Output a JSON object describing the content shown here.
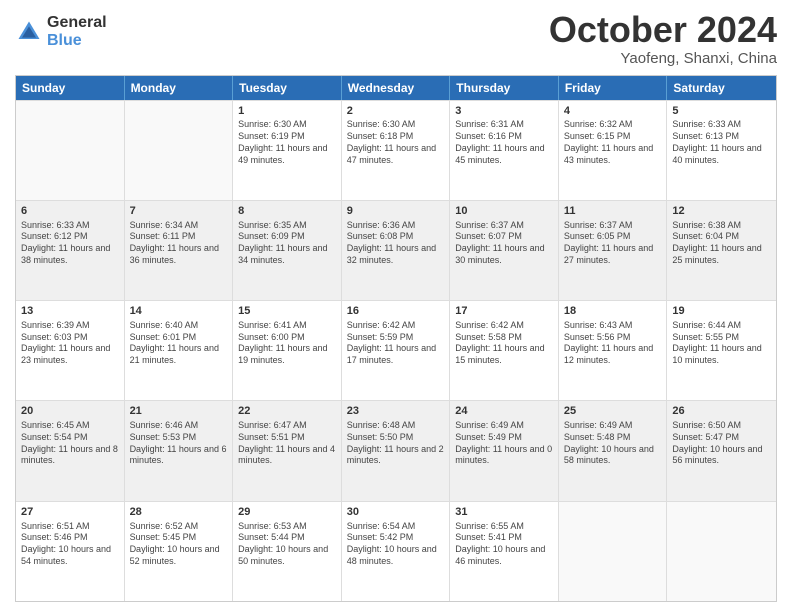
{
  "header": {
    "logo_line1": "General",
    "logo_line2": "Blue",
    "month_title": "October 2024",
    "location": "Yaofeng, Shanxi, China"
  },
  "weekdays": [
    "Sunday",
    "Monday",
    "Tuesday",
    "Wednesday",
    "Thursday",
    "Friday",
    "Saturday"
  ],
  "rows": [
    [
      {
        "day": "",
        "sunrise": "",
        "sunset": "",
        "daylight": "",
        "empty": true
      },
      {
        "day": "",
        "sunrise": "",
        "sunset": "",
        "daylight": "",
        "empty": true
      },
      {
        "day": "1",
        "sunrise": "Sunrise: 6:30 AM",
        "sunset": "Sunset: 6:19 PM",
        "daylight": "Daylight: 11 hours and 49 minutes."
      },
      {
        "day": "2",
        "sunrise": "Sunrise: 6:30 AM",
        "sunset": "Sunset: 6:18 PM",
        "daylight": "Daylight: 11 hours and 47 minutes."
      },
      {
        "day": "3",
        "sunrise": "Sunrise: 6:31 AM",
        "sunset": "Sunset: 6:16 PM",
        "daylight": "Daylight: 11 hours and 45 minutes."
      },
      {
        "day": "4",
        "sunrise": "Sunrise: 6:32 AM",
        "sunset": "Sunset: 6:15 PM",
        "daylight": "Daylight: 11 hours and 43 minutes."
      },
      {
        "day": "5",
        "sunrise": "Sunrise: 6:33 AM",
        "sunset": "Sunset: 6:13 PM",
        "daylight": "Daylight: 11 hours and 40 minutes."
      }
    ],
    [
      {
        "day": "6",
        "sunrise": "Sunrise: 6:33 AM",
        "sunset": "Sunset: 6:12 PM",
        "daylight": "Daylight: 11 hours and 38 minutes."
      },
      {
        "day": "7",
        "sunrise": "Sunrise: 6:34 AM",
        "sunset": "Sunset: 6:11 PM",
        "daylight": "Daylight: 11 hours and 36 minutes."
      },
      {
        "day": "8",
        "sunrise": "Sunrise: 6:35 AM",
        "sunset": "Sunset: 6:09 PM",
        "daylight": "Daylight: 11 hours and 34 minutes."
      },
      {
        "day": "9",
        "sunrise": "Sunrise: 6:36 AM",
        "sunset": "Sunset: 6:08 PM",
        "daylight": "Daylight: 11 hours and 32 minutes."
      },
      {
        "day": "10",
        "sunrise": "Sunrise: 6:37 AM",
        "sunset": "Sunset: 6:07 PM",
        "daylight": "Daylight: 11 hours and 30 minutes."
      },
      {
        "day": "11",
        "sunrise": "Sunrise: 6:37 AM",
        "sunset": "Sunset: 6:05 PM",
        "daylight": "Daylight: 11 hours and 27 minutes."
      },
      {
        "day": "12",
        "sunrise": "Sunrise: 6:38 AM",
        "sunset": "Sunset: 6:04 PM",
        "daylight": "Daylight: 11 hours and 25 minutes."
      }
    ],
    [
      {
        "day": "13",
        "sunrise": "Sunrise: 6:39 AM",
        "sunset": "Sunset: 6:03 PM",
        "daylight": "Daylight: 11 hours and 23 minutes."
      },
      {
        "day": "14",
        "sunrise": "Sunrise: 6:40 AM",
        "sunset": "Sunset: 6:01 PM",
        "daylight": "Daylight: 11 hours and 21 minutes."
      },
      {
        "day": "15",
        "sunrise": "Sunrise: 6:41 AM",
        "sunset": "Sunset: 6:00 PM",
        "daylight": "Daylight: 11 hours and 19 minutes."
      },
      {
        "day": "16",
        "sunrise": "Sunrise: 6:42 AM",
        "sunset": "Sunset: 5:59 PM",
        "daylight": "Daylight: 11 hours and 17 minutes."
      },
      {
        "day": "17",
        "sunrise": "Sunrise: 6:42 AM",
        "sunset": "Sunset: 5:58 PM",
        "daylight": "Daylight: 11 hours and 15 minutes."
      },
      {
        "day": "18",
        "sunrise": "Sunrise: 6:43 AM",
        "sunset": "Sunset: 5:56 PM",
        "daylight": "Daylight: 11 hours and 12 minutes."
      },
      {
        "day": "19",
        "sunrise": "Sunrise: 6:44 AM",
        "sunset": "Sunset: 5:55 PM",
        "daylight": "Daylight: 11 hours and 10 minutes."
      }
    ],
    [
      {
        "day": "20",
        "sunrise": "Sunrise: 6:45 AM",
        "sunset": "Sunset: 5:54 PM",
        "daylight": "Daylight: 11 hours and 8 minutes."
      },
      {
        "day": "21",
        "sunrise": "Sunrise: 6:46 AM",
        "sunset": "Sunset: 5:53 PM",
        "daylight": "Daylight: 11 hours and 6 minutes."
      },
      {
        "day": "22",
        "sunrise": "Sunrise: 6:47 AM",
        "sunset": "Sunset: 5:51 PM",
        "daylight": "Daylight: 11 hours and 4 minutes."
      },
      {
        "day": "23",
        "sunrise": "Sunrise: 6:48 AM",
        "sunset": "Sunset: 5:50 PM",
        "daylight": "Daylight: 11 hours and 2 minutes."
      },
      {
        "day": "24",
        "sunrise": "Sunrise: 6:49 AM",
        "sunset": "Sunset: 5:49 PM",
        "daylight": "Daylight: 11 hours and 0 minutes."
      },
      {
        "day": "25",
        "sunrise": "Sunrise: 6:49 AM",
        "sunset": "Sunset: 5:48 PM",
        "daylight": "Daylight: 10 hours and 58 minutes."
      },
      {
        "day": "26",
        "sunrise": "Sunrise: 6:50 AM",
        "sunset": "Sunset: 5:47 PM",
        "daylight": "Daylight: 10 hours and 56 minutes."
      }
    ],
    [
      {
        "day": "27",
        "sunrise": "Sunrise: 6:51 AM",
        "sunset": "Sunset: 5:46 PM",
        "daylight": "Daylight: 10 hours and 54 minutes."
      },
      {
        "day": "28",
        "sunrise": "Sunrise: 6:52 AM",
        "sunset": "Sunset: 5:45 PM",
        "daylight": "Daylight: 10 hours and 52 minutes."
      },
      {
        "day": "29",
        "sunrise": "Sunrise: 6:53 AM",
        "sunset": "Sunset: 5:44 PM",
        "daylight": "Daylight: 10 hours and 50 minutes."
      },
      {
        "day": "30",
        "sunrise": "Sunrise: 6:54 AM",
        "sunset": "Sunset: 5:42 PM",
        "daylight": "Daylight: 10 hours and 48 minutes."
      },
      {
        "day": "31",
        "sunrise": "Sunrise: 6:55 AM",
        "sunset": "Sunset: 5:41 PM",
        "daylight": "Daylight: 10 hours and 46 minutes."
      },
      {
        "day": "",
        "sunrise": "",
        "sunset": "",
        "daylight": "",
        "empty": true
      },
      {
        "day": "",
        "sunrise": "",
        "sunset": "",
        "daylight": "",
        "empty": true
      }
    ]
  ]
}
